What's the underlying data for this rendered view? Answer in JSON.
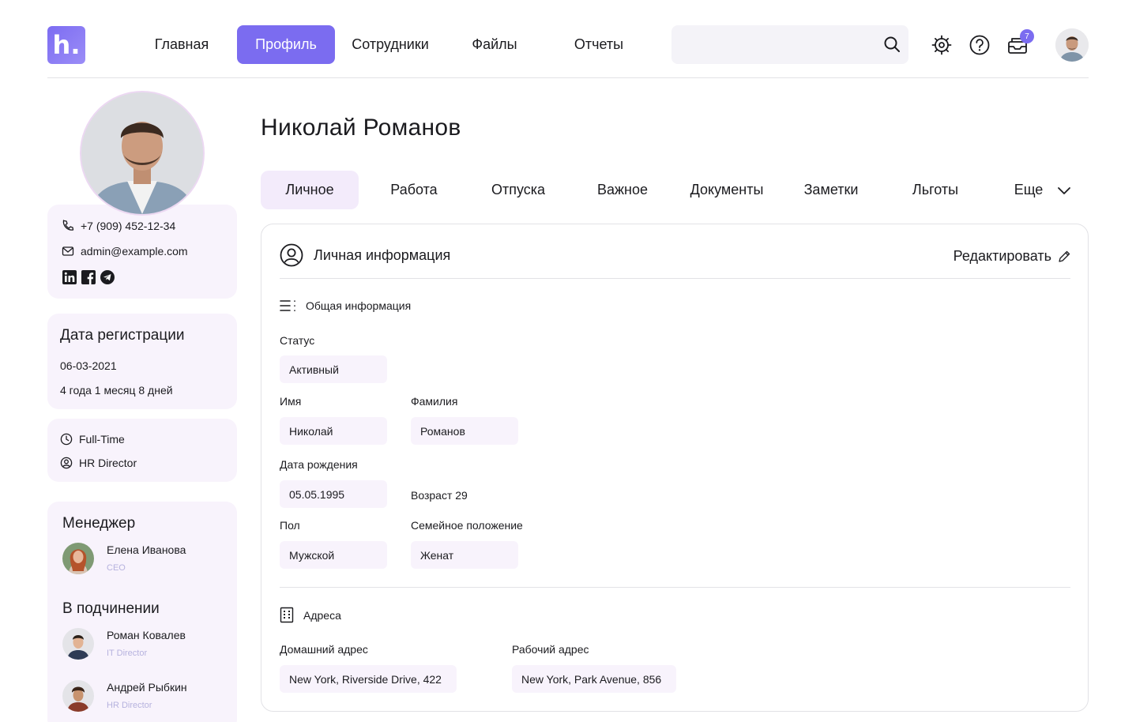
{
  "header": {
    "logo_letter": "h.",
    "nav": [
      {
        "label": "Главная",
        "active": false
      },
      {
        "label": "Профиль",
        "active": true
      },
      {
        "label": "Сотрудники",
        "active": false
      },
      {
        "label": "Файлы",
        "active": false
      },
      {
        "label": "Отчеты",
        "active": false
      }
    ],
    "search": {
      "value": "",
      "placeholder": ""
    },
    "notifications_count": "7"
  },
  "profile": {
    "phone": "+7 (909) 452-12-34",
    "email": "admin@example.com",
    "social_icons": [
      "linkedin-icon",
      "facebook-icon",
      "telegram-icon"
    ]
  },
  "registration": {
    "title": "Дата регистрации",
    "date": "06-03-2021",
    "duration": "4 года 1 месяц 8 дней"
  },
  "employment": {
    "type": "Full-Time",
    "position": "HR Director"
  },
  "manager": {
    "title": "Менеджер",
    "name": "Елена Иванова",
    "role": "CEO"
  },
  "subordinates": {
    "title": "В подчинении",
    "people": [
      {
        "name": "Роман Ковалев",
        "role": "IT Director"
      },
      {
        "name": "Андрей Рыбкин",
        "role": "HR Director"
      }
    ]
  },
  "main": {
    "employee_name": "Николай Романов",
    "tabs": [
      "Личное",
      "Работа",
      "Отпуска",
      "Важное",
      "Документы",
      "Заметки",
      "Льготы",
      "Еще"
    ],
    "active_tab": "Личное",
    "panel_title": "Личная информация",
    "edit_label": "Редактировать",
    "general": {
      "title": "Общая информация",
      "status_label": "Статус",
      "status": "Активный",
      "first_name_label": "Имя",
      "first_name": "Николай",
      "last_name_label": "Фамилия",
      "last_name": "Романов",
      "birth_label": "Дата рождения",
      "birth_date": "05.05.1995",
      "age": "Возраст 29",
      "gender_label": "Пол",
      "gender": "Мужской",
      "marital_label": "Семейное положение",
      "marital": "Женат"
    },
    "addresses": {
      "title": "Адреса",
      "home_label": "Домашний адрес",
      "home": "New York, Riverside Drive, 422",
      "work_label": "Рабочий адрес",
      "work": "New York, Park Avenue, 856"
    }
  },
  "colors": {
    "accent": "#7b6cf0",
    "card_bg": "#f8f3fc",
    "role_text": "#b6b2de"
  }
}
